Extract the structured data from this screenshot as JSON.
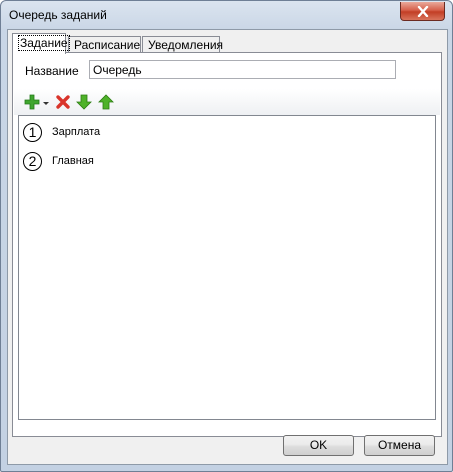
{
  "window": {
    "title": "Очередь заданий"
  },
  "tabs": [
    {
      "label": "Задание",
      "active": true
    },
    {
      "label": "Расписание",
      "active": false
    },
    {
      "label": "Уведомления",
      "active": false
    }
  ],
  "form": {
    "name_label": "Название",
    "name_value": "Очередь"
  },
  "toolbar": {
    "buttons": [
      {
        "name": "add-icon",
        "color": "#3fa62e"
      },
      {
        "name": "delete-icon",
        "color": "#d9342b"
      },
      {
        "name": "move-down-icon",
        "color": "#4fb22a"
      },
      {
        "name": "move-up-icon",
        "color": "#4fb22a"
      }
    ]
  },
  "list": {
    "items": [
      {
        "number": "1",
        "label": "Зарплата"
      },
      {
        "number": "2",
        "label": "Главная"
      }
    ]
  },
  "buttons": {
    "ok": "OK",
    "cancel": "Отмена"
  }
}
